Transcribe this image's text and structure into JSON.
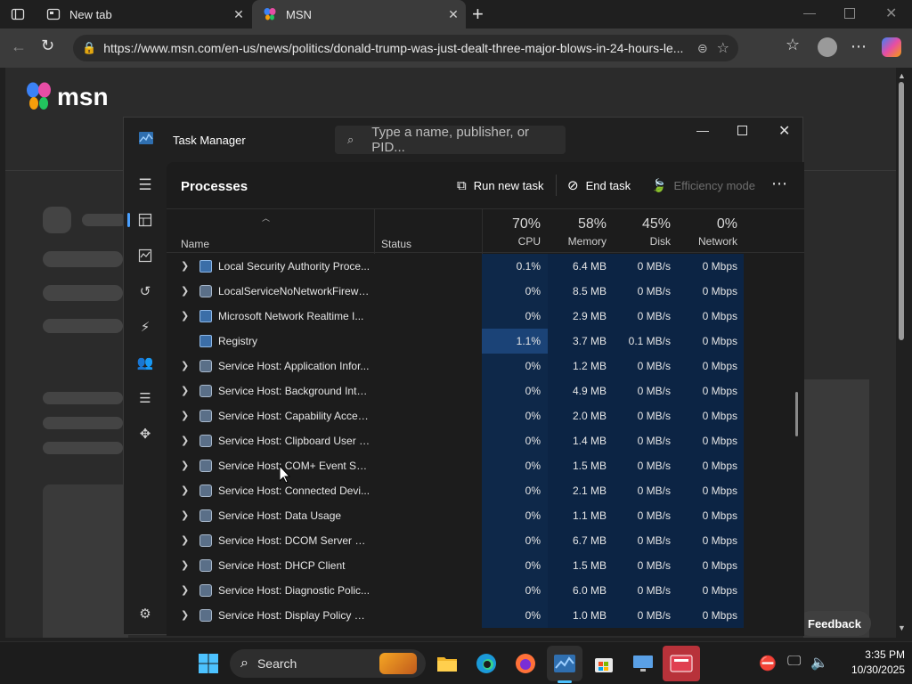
{
  "browser": {
    "tabs": [
      {
        "label": "New tab",
        "active": false
      },
      {
        "label": "MSN",
        "active": true
      }
    ],
    "address": "https://www.msn.com/en-us/news/politics/donald-trump-was-just-dealt-three-major-blows-in-24-hours-le...",
    "new_tab_symbol": "+"
  },
  "site": {
    "logo_text": "msn",
    "feedback_label": "Feedback"
  },
  "task_manager": {
    "title": "Task Manager",
    "search_placeholder": "Type a name, publisher, or PID...",
    "section_title": "Processes",
    "commands": {
      "run_new_task": "Run new task",
      "end_task": "End task",
      "efficiency_mode": "Efficiency mode"
    },
    "columns": {
      "name": "Name",
      "status": "Status",
      "cpu": {
        "label": "CPU",
        "pct": "70%"
      },
      "memory": {
        "label": "Memory",
        "pct": "58%"
      },
      "disk": {
        "label": "Disk",
        "pct": "45%"
      },
      "network": {
        "label": "Network",
        "pct": "0%"
      }
    },
    "rows": [
      {
        "name": "Local Security Authority Proce...",
        "cpu": "0.1%",
        "mem": "6.4 MB",
        "disk": "0 MB/s",
        "net": "0 Mbps",
        "expandable": true,
        "icon": "window"
      },
      {
        "name": "LocalServiceNoNetworkFirewa...",
        "cpu": "0%",
        "mem": "8.5 MB",
        "disk": "0 MB/s",
        "net": "0 Mbps",
        "expandable": true,
        "icon": "gear"
      },
      {
        "name": "Microsoft Network Realtime I...",
        "cpu": "0%",
        "mem": "2.9 MB",
        "disk": "0 MB/s",
        "net": "0 Mbps",
        "expandable": true,
        "icon": "window"
      },
      {
        "name": "Registry",
        "cpu": "1.1%",
        "mem": "3.7 MB",
        "disk": "0.1 MB/s",
        "net": "0 Mbps",
        "expandable": false,
        "icon": "window"
      },
      {
        "name": "Service Host: Application Infor...",
        "cpu": "0%",
        "mem": "1.2 MB",
        "disk": "0 MB/s",
        "net": "0 Mbps",
        "expandable": true,
        "icon": "gear"
      },
      {
        "name": "Service Host: Background Inte...",
        "cpu": "0%",
        "mem": "4.9 MB",
        "disk": "0 MB/s",
        "net": "0 Mbps",
        "expandable": true,
        "icon": "gear"
      },
      {
        "name": "Service Host: Capability Acces...",
        "cpu": "0%",
        "mem": "2.0 MB",
        "disk": "0 MB/s",
        "net": "0 Mbps",
        "expandable": true,
        "icon": "gear"
      },
      {
        "name": "Service Host: Clipboard User S...",
        "cpu": "0%",
        "mem": "1.4 MB",
        "disk": "0 MB/s",
        "net": "0 Mbps",
        "expandable": true,
        "icon": "gear"
      },
      {
        "name": "Service Host: COM+ Event Sys...",
        "cpu": "0%",
        "mem": "1.5 MB",
        "disk": "0 MB/s",
        "net": "0 Mbps",
        "expandable": true,
        "icon": "gear"
      },
      {
        "name": "Service Host: Connected Devi...",
        "cpu": "0%",
        "mem": "2.1 MB",
        "disk": "0 MB/s",
        "net": "0 Mbps",
        "expandable": true,
        "icon": "gear"
      },
      {
        "name": "Service Host: Data Usage",
        "cpu": "0%",
        "mem": "1.1 MB",
        "disk": "0 MB/s",
        "net": "0 Mbps",
        "expandable": true,
        "icon": "gear"
      },
      {
        "name": "Service Host: DCOM Server Pr...",
        "cpu": "0%",
        "mem": "6.7 MB",
        "disk": "0 MB/s",
        "net": "0 Mbps",
        "expandable": true,
        "icon": "gear"
      },
      {
        "name": "Service Host: DHCP Client",
        "cpu": "0%",
        "mem": "1.5 MB",
        "disk": "0 MB/s",
        "net": "0 Mbps",
        "expandable": true,
        "icon": "gear"
      },
      {
        "name": "Service Host: Diagnostic Polic...",
        "cpu": "0%",
        "mem": "6.0 MB",
        "disk": "0 MB/s",
        "net": "0 Mbps",
        "expandable": true,
        "icon": "gear"
      },
      {
        "name": "Service Host: Display Policy Se...",
        "cpu": "0%",
        "mem": "1.0 MB",
        "disk": "0 MB/s",
        "net": "0 Mbps",
        "expandable": true,
        "icon": "gear"
      }
    ]
  },
  "taskbar": {
    "search_label": "Search",
    "clock_time": "3:35 PM",
    "clock_date": "10/30/2025"
  },
  "colors": {
    "accent": "#0078d4",
    "heat_cell": "#0e2849",
    "heat_cell_hot": "#1b4377"
  }
}
